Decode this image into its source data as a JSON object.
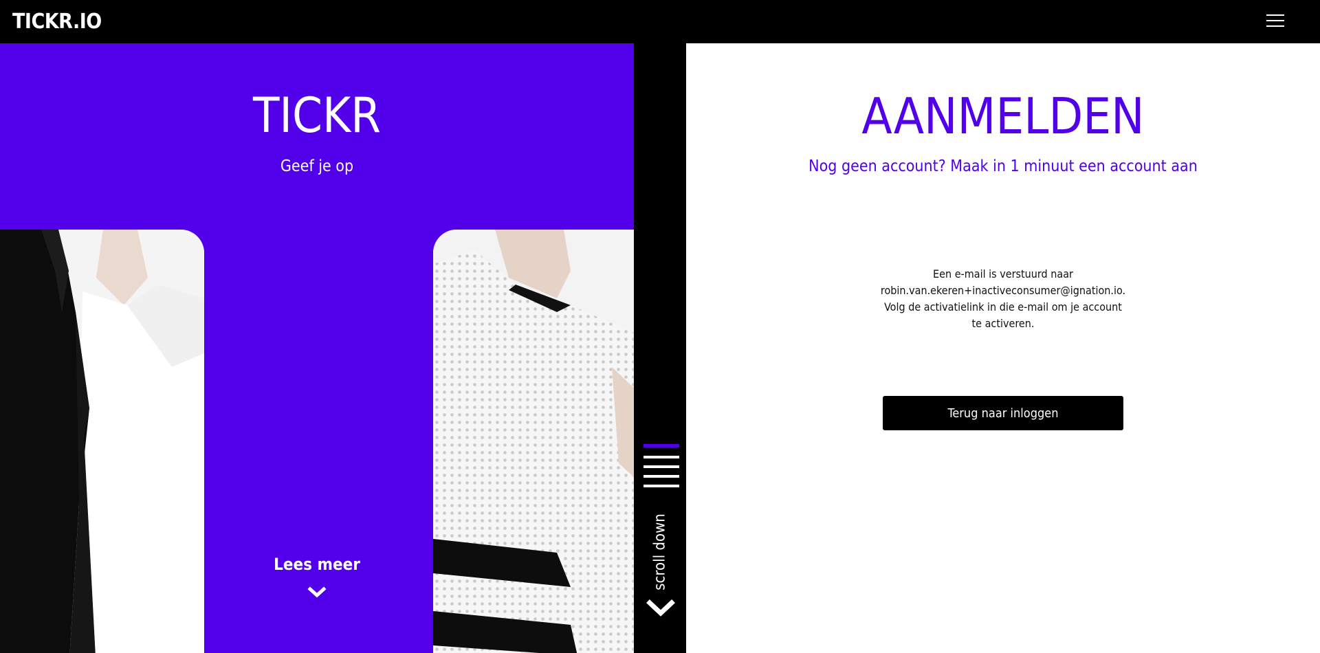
{
  "header": {
    "logo": "TICKR.IO",
    "menu_icon": "hamburger-menu-icon"
  },
  "hero": {
    "title": "TICKR",
    "subtitle": "Geef je op",
    "read_more": "Lees meer",
    "read_more_icon": "chevron-down-icon"
  },
  "divider": {
    "scroll_label": "scroll down",
    "scroll_icon": "chevron-down-icon"
  },
  "form": {
    "title": "AANMELDEN",
    "signup_prompt": "Nog geen account? Maak in 1 minuut een account aan",
    "message_lines": [
      "Een e-mail is verstuurd naar",
      "robin.van.ekeren+inactiveconsumer@ignation.io.",
      "Volg de activatielink in die e-mail om je account",
      "te activeren."
    ],
    "back_button": "Terug naar inloggen"
  },
  "colors": {
    "brand_purple": "#5200ea",
    "black": "#000000",
    "white": "#ffffff"
  }
}
